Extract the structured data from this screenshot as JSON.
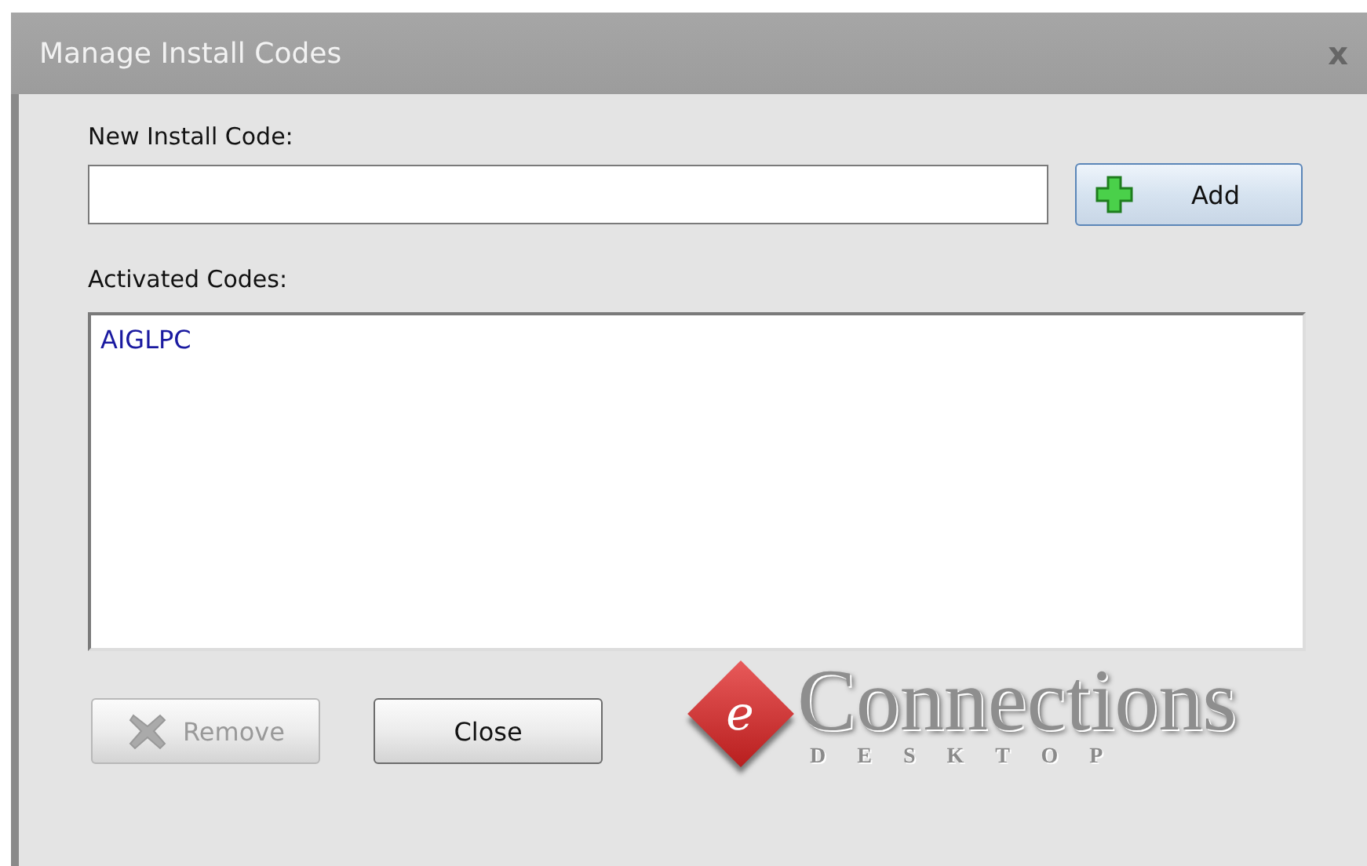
{
  "window": {
    "title": "Manage Install Codes",
    "close": "x"
  },
  "new_code": {
    "label": "New Install Code:"
  },
  "add_button": {
    "label": "Add",
    "disabled": false
  },
  "activated": {
    "label": "Activated Codes:",
    "items": [
      {
        "text": "AIGLPC",
        "selected": false
      }
    ]
  },
  "buttons": [
    {
      "kind": "remove",
      "label": "Remove",
      "disabled": true
    },
    {
      "kind": "close",
      "label": "Close",
      "disabled": false
    }
  ],
  "logo": {
    "mark": "e",
    "name": "Connections",
    "tagline": "DESKTOP"
  }
}
